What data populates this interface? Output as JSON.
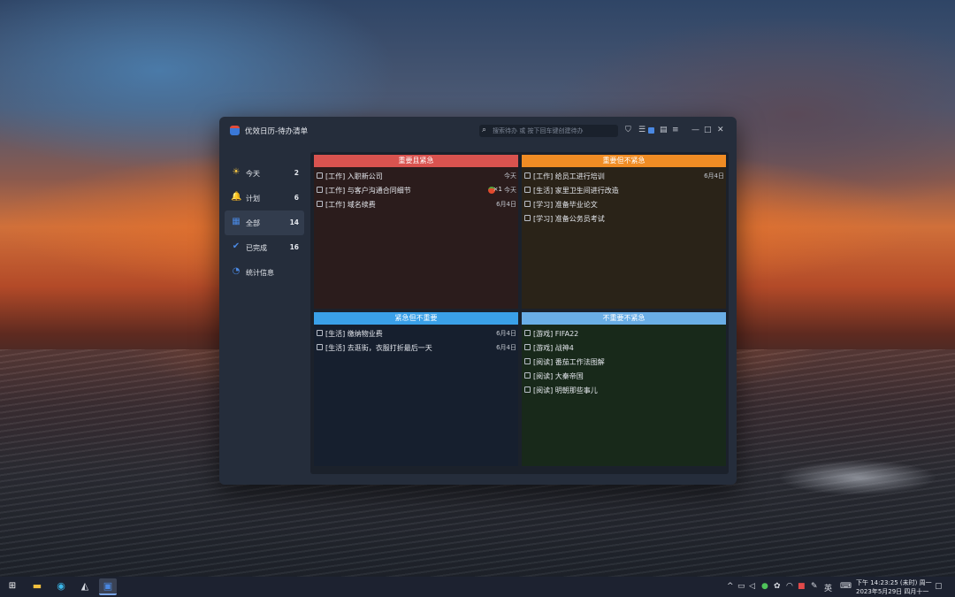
{
  "window": {
    "title": "优效日历-待办清单",
    "search_placeholder": "搜索待办 或 按下回车键创建待办",
    "accent": "#4a88e2"
  },
  "sidebar": {
    "items": [
      {
        "icon": "sun-icon",
        "label": "今天",
        "count": "2"
      },
      {
        "icon": "bell-icon",
        "label": "计划",
        "count": "6"
      },
      {
        "icon": "grid-icon",
        "label": "全部",
        "count": "14",
        "active": true
      },
      {
        "icon": "check-circle-icon",
        "label": "已完成",
        "count": "16"
      },
      {
        "icon": "pie-chart-icon",
        "label": "统计信息",
        "count": ""
      }
    ]
  },
  "quadrants": [
    {
      "title": "重要且紧急",
      "header_color": "#d9534f",
      "body_color": "#2b1c1c",
      "tasks": [
        {
          "text": "[工作] 入职新公司",
          "date": "今天"
        },
        {
          "text": "[工作] 与客户沟通合同细节",
          "date": "今天",
          "tomato": "×1"
        },
        {
          "text": "[工作] 域名续费",
          "date": "6月4日"
        }
      ]
    },
    {
      "title": "重要但不紧急",
      "header_color": "#f08c24",
      "body_color": "#2a2318",
      "tasks": [
        {
          "text": "[工作] 给员工进行培训",
          "date": "6月4日"
        },
        {
          "text": "[生活] 家里卫生间进行改造",
          "date": ""
        },
        {
          "text": "[学习] 准备毕业论文",
          "date": ""
        },
        {
          "text": "[学习] 准备公务员考试",
          "date": ""
        }
      ]
    },
    {
      "title": "紧急但不重要",
      "header_color": "#3aa0e8",
      "body_color": "#161f2e",
      "tasks": [
        {
          "text": "[生活] 缴纳物业费",
          "date": "6月4日"
        },
        {
          "text": "[生活] 去逛街，衣服打折最后一天",
          "date": "6月4日"
        }
      ]
    },
    {
      "title": "不重要不紧急",
      "header_color": "#6aaee6",
      "body_color": "#18291a",
      "tasks": [
        {
          "text": "[游戏] FIFA22",
          "date": ""
        },
        {
          "text": "[游戏] 战神4",
          "date": ""
        },
        {
          "text": "[阅读] 番茄工作法图解",
          "date": ""
        },
        {
          "text": "[阅读] 大秦帝国",
          "date": ""
        },
        {
          "text": "[阅读] 明朝那些事儿",
          "date": ""
        }
      ]
    }
  ],
  "taskbar": {
    "ime": "英",
    "clock_line1": "下午 14:23:25 (未时) 周一",
    "clock_line2": "2023年5月29日 四月十一"
  }
}
